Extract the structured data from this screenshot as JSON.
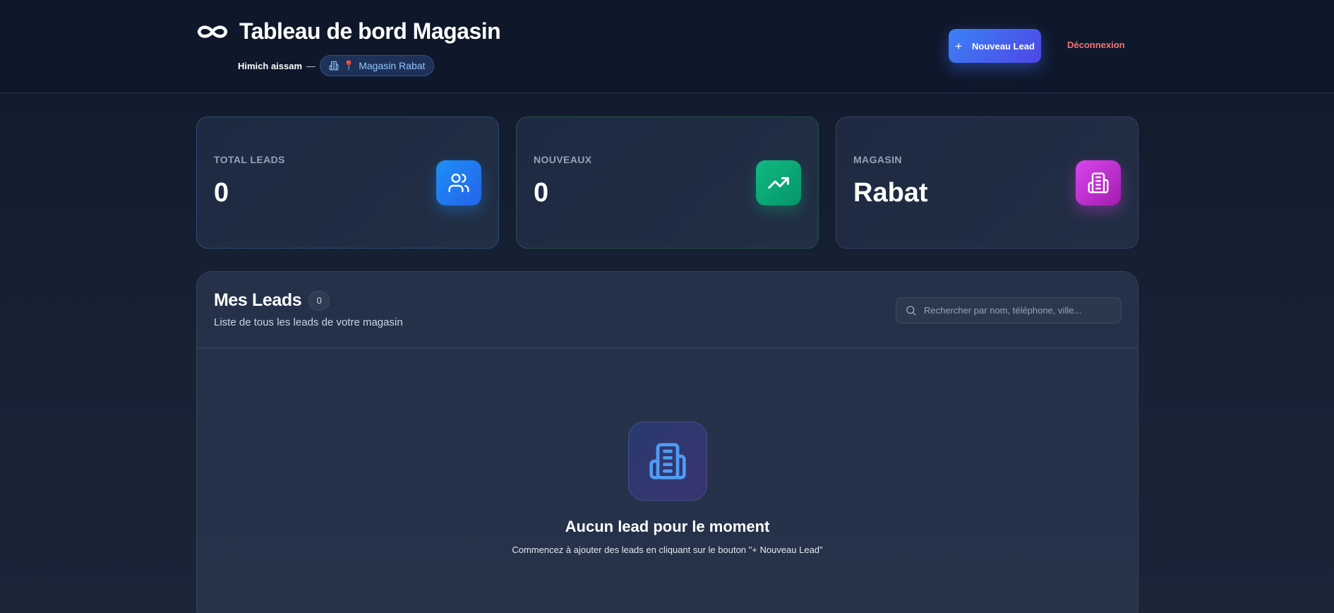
{
  "header": {
    "title": "Tableau de bord Magasin",
    "logo_icon": "infinity-icon",
    "user_name": "Himich aissam",
    "separator": "—",
    "store_badge": {
      "icon": "building-icon",
      "pin": "📍",
      "label": "Magasin Rabat"
    },
    "new_lead_button": {
      "plus": "+",
      "label": "Nouveau Lead"
    },
    "logout_label": "Déconnexion"
  },
  "stats": [
    {
      "label": "TOTAL LEADS",
      "value": "0",
      "icon": "users-icon",
      "accent": "#1d8ff5"
    },
    {
      "label": "NOUVEAUX",
      "value": "0",
      "icon": "trending-up-icon",
      "accent": "#10b981"
    },
    {
      "label": "MAGASIN",
      "value": "Rabat",
      "icon": "building-icon",
      "accent": "#d946ef"
    }
  ],
  "leads_panel": {
    "title": "Mes Leads",
    "count": "0",
    "subtitle": "Liste de tous les leads de votre magasin",
    "search": {
      "placeholder": "Rechercher par nom, téléphone, ville...",
      "value": ""
    },
    "empty_state": {
      "icon": "building-icon",
      "title": "Aucun lead pour le moment",
      "text": "Commencez à ajouter des leads en cliquant sur le bouton \"+ Nouveau Lead\""
    }
  },
  "colors": {
    "background": "#141d2e",
    "primary": "#3b82f6",
    "danger": "#f87171"
  }
}
